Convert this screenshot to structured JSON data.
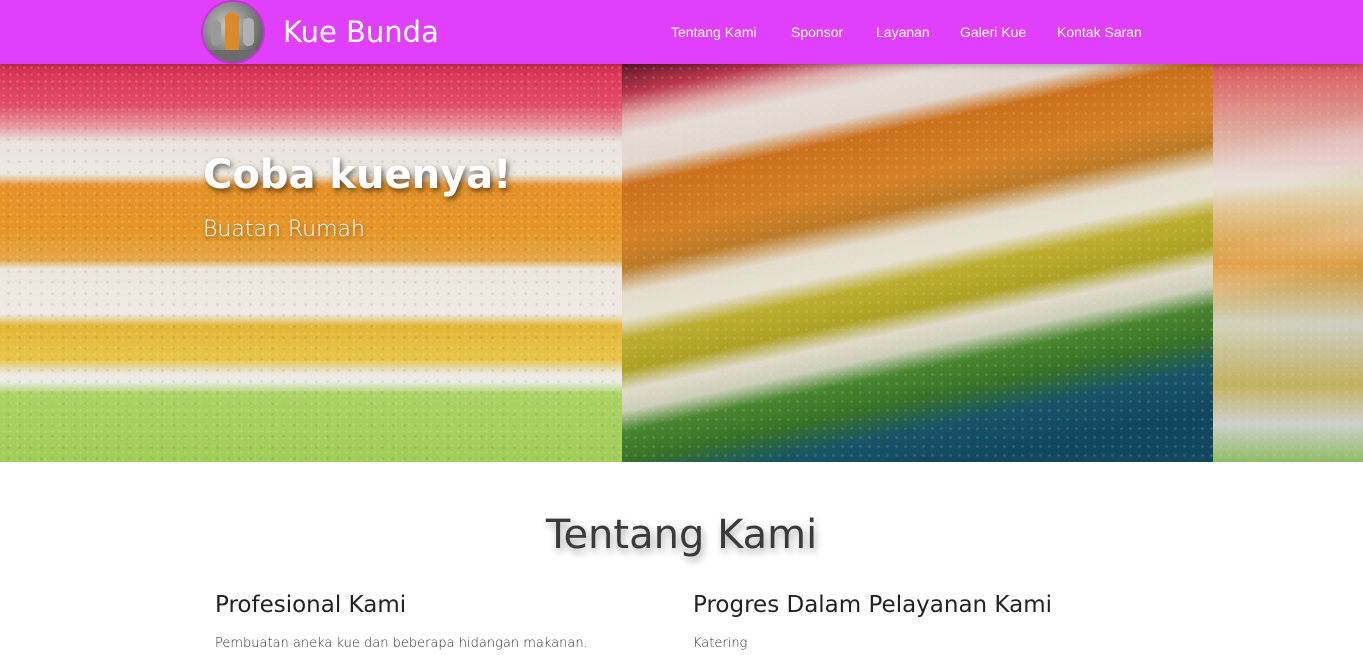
{
  "navbar": {
    "brand": "Kue Bunda",
    "logo_icon": "bakery-logo-avatar",
    "background": "#e040fb",
    "links": [
      "Tentang Kami",
      "Sponsor",
      "Layanan",
      "Galeri Kue",
      "Kontak Saran"
    ]
  },
  "hero": {
    "title": "Coba kuenya!",
    "subtitle": "Buatan Rumah",
    "image": "rainbow-layer-cake-photo"
  },
  "about": {
    "title": "Tentang Kami",
    "columns": [
      {
        "heading": "Profesional Kami",
        "text": "Pembuatan aneka kue dan beberapa hidangan makanan."
      },
      {
        "heading": "Progres Dalam Pelayanan Kami",
        "text": "Katering"
      }
    ]
  }
}
